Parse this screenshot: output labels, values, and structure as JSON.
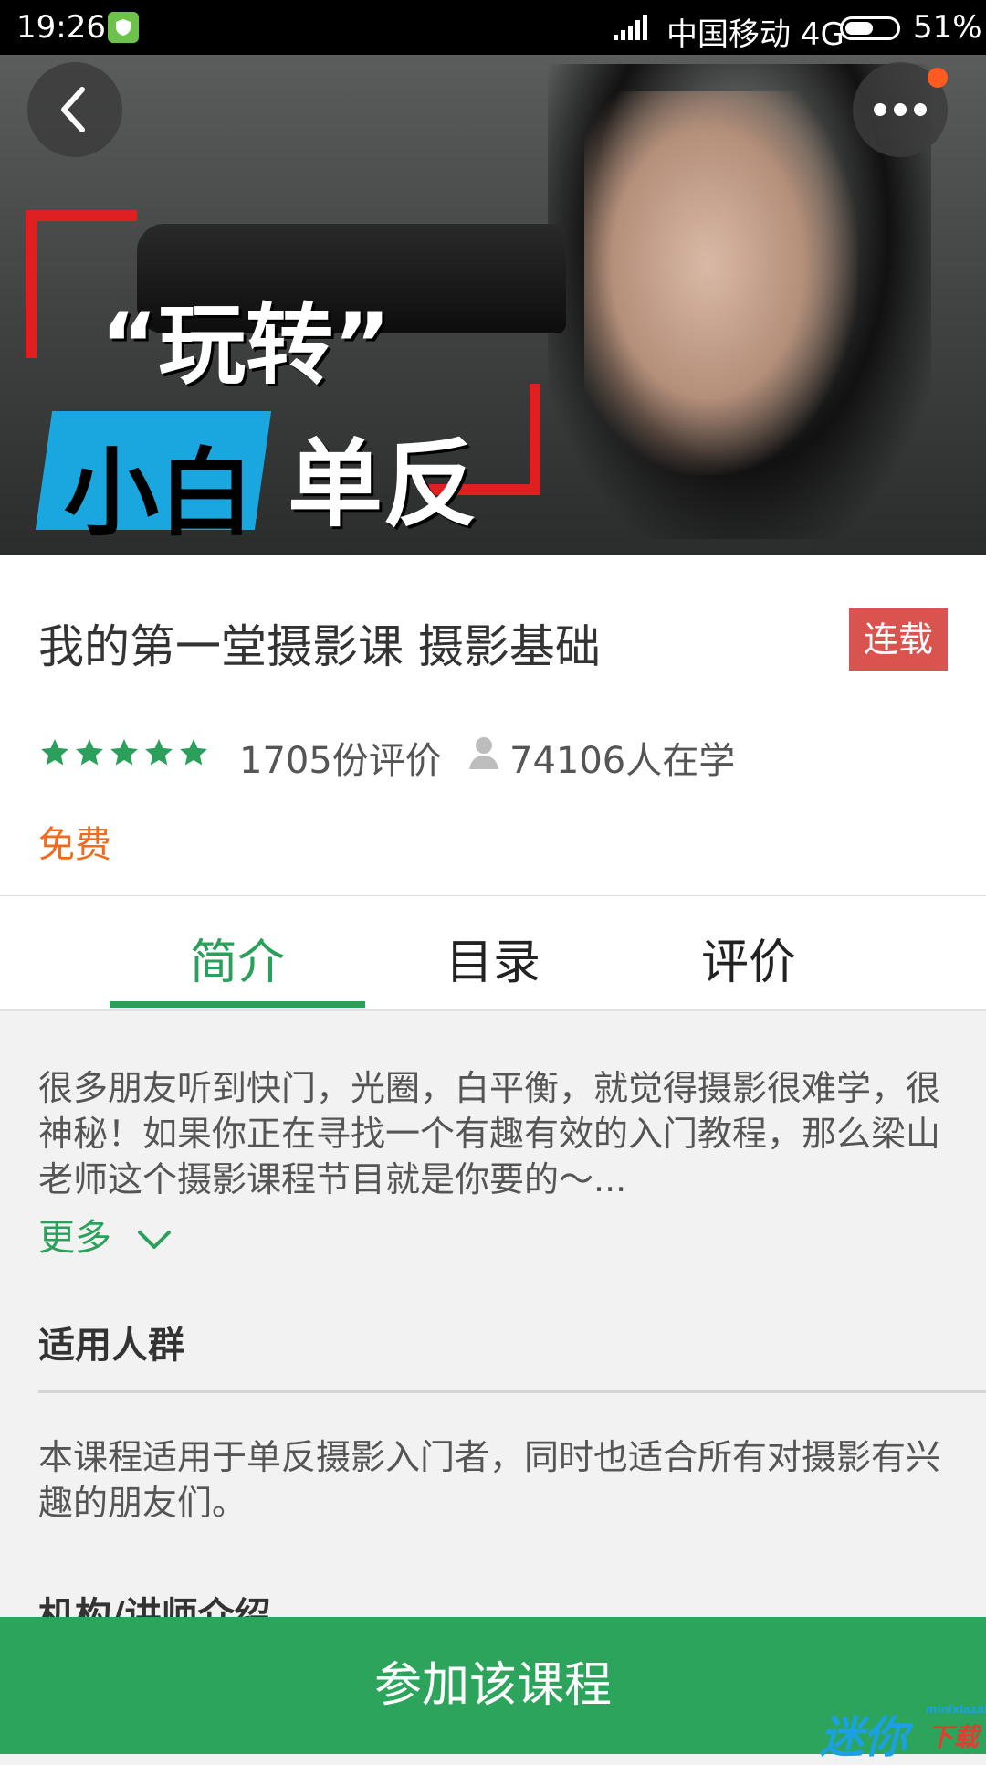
{
  "status_bar": {
    "time": "19:26",
    "carrier": "中国移动 4G",
    "battery": "51%"
  },
  "banner": {
    "title_line1": "“玩转”",
    "title_highlight": "小白",
    "title_rest": "单反"
  },
  "course": {
    "title": "我的第一堂摄影课 摄影基础",
    "status_tag": "连载",
    "rating_stars": 5,
    "review_count": "1705份评价",
    "learners": "74106人在学",
    "price": "免费"
  },
  "tabs": [
    {
      "label": "简介",
      "active": true
    },
    {
      "label": "目录",
      "active": false
    },
    {
      "label": "评价",
      "active": false
    }
  ],
  "intro": {
    "description": "很多朋友听到快门，光圈，白平衡，就觉得摄影很难学，很神秘！如果你正在寻找一个有趣有效的入门教程，那么梁山老师这个摄影课程节目就是你要的～...",
    "more_label": "更多",
    "audience_heading": "适用人群",
    "audience_text": "本课程适用于单反摄影入门者，同时也适合所有对摄影有兴趣的朋友们。",
    "teacher_heading": "机构/讲师介绍"
  },
  "actions": {
    "join_label": "参加该课程"
  },
  "watermark": {
    "main": "迷你",
    "small": "minixiazai",
    "red": "下载"
  },
  "colors": {
    "accent_green": "#2aa05a",
    "tag_red": "#d9534f",
    "price_orange": "#f26b1d"
  }
}
